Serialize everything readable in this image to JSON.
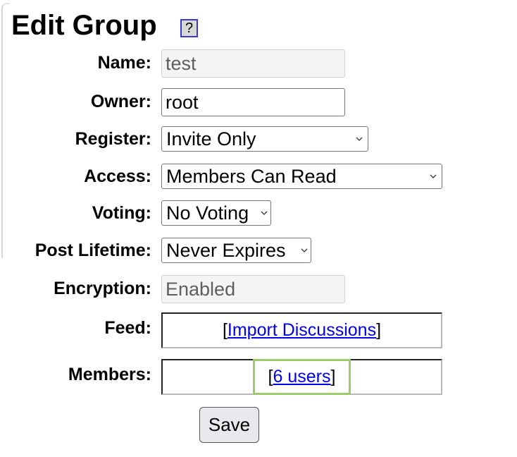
{
  "page": {
    "title": "Edit Group",
    "help_label": "?"
  },
  "form": {
    "name": {
      "label": "Name:",
      "value": "test",
      "disabled": true
    },
    "owner": {
      "label": "Owner:",
      "value": "root"
    },
    "register": {
      "label": "Register:",
      "selected": "Invite Only"
    },
    "access": {
      "label": "Access:",
      "selected": "Members Can Read"
    },
    "voting": {
      "label": "Voting:",
      "selected": "No Voting"
    },
    "post_lifetime": {
      "label": "Post Lifetime:",
      "selected": "Never Expires"
    },
    "encryption": {
      "label": "Encryption:",
      "value": "Enabled",
      "disabled": true
    },
    "feed": {
      "label": "Feed:",
      "bracket_open": "[",
      "link_text": "Import Discussions",
      "bracket_close": "]"
    },
    "members": {
      "label": "Members:",
      "bracket_open": "[",
      "link_text": "6 users",
      "bracket_close": "]"
    },
    "save_label": "Save"
  },
  "colors": {
    "link": "#0000ee",
    "highlight": "#9ccc6a",
    "help_border": "#3b3bd0"
  }
}
